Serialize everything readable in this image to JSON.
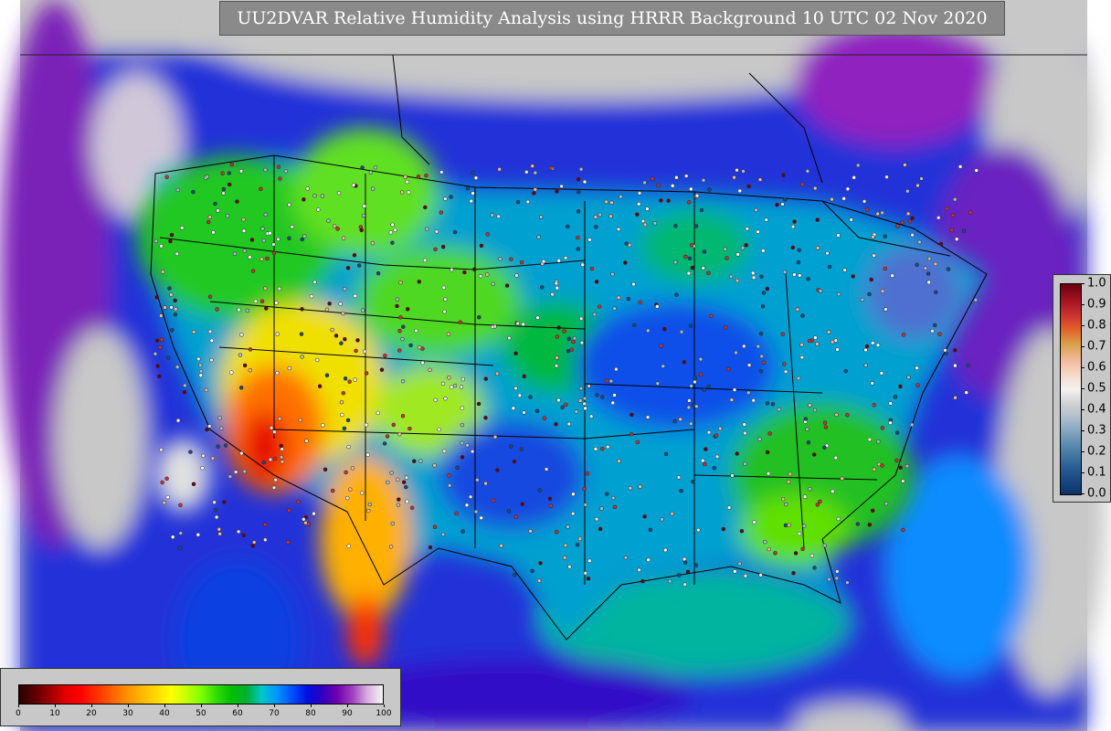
{
  "title": "UU2DVAR Relative Humidity Analysis using HRRR Background 10 UTC 02 Nov 2020",
  "rh_colorbar": {
    "ticks": [
      "0",
      "10",
      "20",
      "30",
      "40",
      "50",
      "60",
      "70",
      "80",
      "90",
      "100"
    ],
    "stops": [
      "#2a0000",
      "#5a0000",
      "#9a0000",
      "#e00000",
      "#ff0000",
      "#ff2a00",
      "#ff5a00",
      "#ff8c00",
      "#ffb400",
      "#ffd700",
      "#ffff00",
      "#c8ff00",
      "#7fff00",
      "#33dd00",
      "#00c000",
      "#00b030",
      "#00c8c8",
      "#0096ff",
      "#0050ff",
      "#0010e0",
      "#3000c0",
      "#7000b0",
      "#a040c0",
      "#d8b0e0",
      "#f4f4f4"
    ]
  },
  "obs_colorbar": {
    "ticks": [
      "1.0",
      "0.9",
      "0.8",
      "0.7",
      "0.6",
      "0.5",
      "0.4",
      "0.3",
      "0.2",
      "0.1",
      "0.0"
    ],
    "stops": [
      "#6b0010",
      "#a01020",
      "#c83030",
      "#e0602a",
      "#d9a14a",
      "#f0b89a",
      "#f5d8c8",
      "#f2f2f2",
      "#d0d0d0",
      "#a8bccc",
      "#7aa0bc",
      "#4f82aa",
      "#2f6496",
      "#1a4a80",
      "#0e3366"
    ]
  }
}
